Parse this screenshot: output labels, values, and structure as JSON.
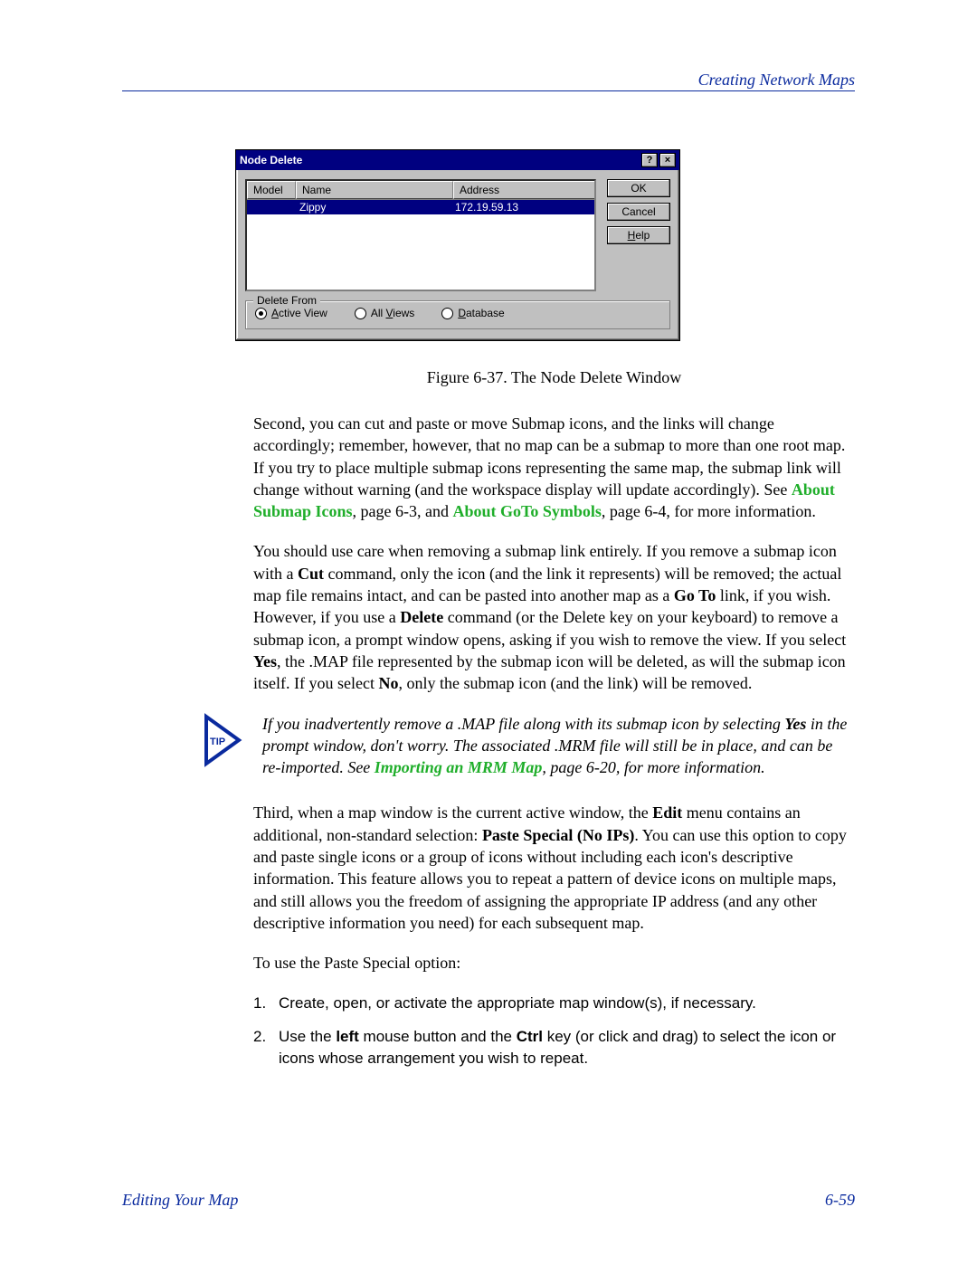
{
  "header": {
    "right": "Creating Network Maps"
  },
  "dialog": {
    "title": "Node Delete",
    "help_glyph": "?",
    "close_glyph": "×",
    "columns": {
      "model": "Model",
      "name": "Name",
      "address": "Address"
    },
    "row": {
      "name": "Zippy",
      "address": "172.19.59.13"
    },
    "buttons": {
      "ok": "OK",
      "cancel": "Cancel",
      "help": "Help",
      "help_u": "H"
    },
    "group_label": "Delete From",
    "radios": {
      "active": {
        "u": "A",
        "rest": "ctive View"
      },
      "all": {
        "pre": "All ",
        "u": "V",
        "rest": "iews"
      },
      "db": {
        "u": "D",
        "rest": "atabase"
      }
    }
  },
  "caption": "Figure 6-37. The Node Delete Window",
  "p1": {
    "a": "Second, you can cut and paste or move Submap icons, and the links will change accordingly; remember, however, that no map can be a submap to more than one root map. If you try to place multiple submap icons representing the same map, the submap link will change without warning (and the workspace display will update accordingly). See ",
    "link1": "About Submap Icons",
    "mid1": ", page 6-3, and ",
    "link2": "About GoTo Symbols",
    "end": ", page 6-4, for more information."
  },
  "p2": {
    "a": "You should use care when removing a submap link entirely. If you remove a submap icon with a ",
    "b1": "Cut",
    "b": " command, only the icon (and the link it represents) will be removed; the actual map file remains intact, and can be pasted into another map as a ",
    "b2": "Go To",
    "c": " link, if you wish. However, if you use a ",
    "b3": "Delete",
    "d": " command (or the Delete key on your keyboard) to remove a submap icon, a prompt window opens, asking if you wish to remove the view. If you select ",
    "b4": "Yes",
    "e": ", the .MAP file represented by the submap icon will be deleted, as will the submap icon itself. If you select ",
    "b5": "No",
    "f": ", only the submap icon (and the link) will be removed."
  },
  "tip": {
    "label": "TIP",
    "a": "If you inadvertently remove a .MAP file along with its submap icon by selecting ",
    "b1": "Yes",
    "b": " in the prompt window, don't worry. The associated .MRM file will still be in place, and can be re-imported. See ",
    "link": "Importing an MRM Map",
    "c": ", page 6-20, for more information."
  },
  "p3": {
    "a": "Third, when a map window is the current active window, the ",
    "b1": "Edit",
    "b": " menu contains an additional, non-standard selection: ",
    "b2": "Paste Special (No IPs)",
    "c": ". You can use this option to copy and paste single icons or a group of icons without including each icon's descriptive information. This feature allows you to repeat a pattern of device icons on multiple maps, and still allows you the freedom of assigning the appropriate IP address (and any other descriptive information you need) for each subsequent map."
  },
  "p4": "To use the Paste Special option:",
  "list": {
    "n1": "1.",
    "t1": "Create, open, or activate the appropriate map window(s), if necessary.",
    "n2": "2.",
    "t2a": "Use the ",
    "t2b1": "left",
    "t2b": " mouse button and the ",
    "t2b2": "Ctrl",
    "t2c": " key (or click and drag) to select the icon or icons whose arrangement you wish to repeat."
  },
  "footer": {
    "left": "Editing Your Map",
    "right": "6-59"
  }
}
